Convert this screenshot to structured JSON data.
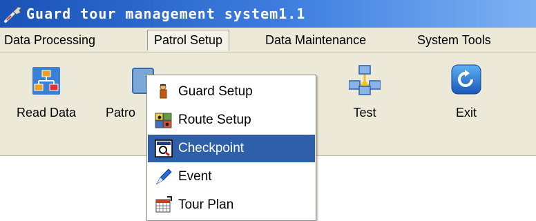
{
  "window": {
    "title": "Guard tour management system1.1",
    "title_bar_color": "#2a62c8"
  },
  "menubar": {
    "items": [
      {
        "label": "Data Processing"
      },
      {
        "label": "Patrol Setup",
        "open": true
      },
      {
        "label": "Data Maintenance"
      },
      {
        "label": "System Tools"
      }
    ]
  },
  "toolbar": {
    "buttons": [
      {
        "label": "Read Data",
        "icon": "read-data-icon"
      },
      {
        "label": "Patro",
        "icon": "patrol-icon"
      },
      {
        "label": "Test",
        "icon": "network-test-icon"
      },
      {
        "label": "Exit",
        "icon": "exit-icon"
      }
    ]
  },
  "dropdown": {
    "items": [
      {
        "label": "Guard Setup",
        "icon": "guard-icon"
      },
      {
        "label": "Route Setup",
        "icon": "route-icon"
      },
      {
        "label": "Checkpoint",
        "icon": "checkpoint-icon",
        "selected": true
      },
      {
        "label": "Event",
        "icon": "pen-icon"
      },
      {
        "label": "Tour Plan",
        "icon": "calendar-icon"
      }
    ],
    "highlight_color": "#2f5fa8"
  }
}
